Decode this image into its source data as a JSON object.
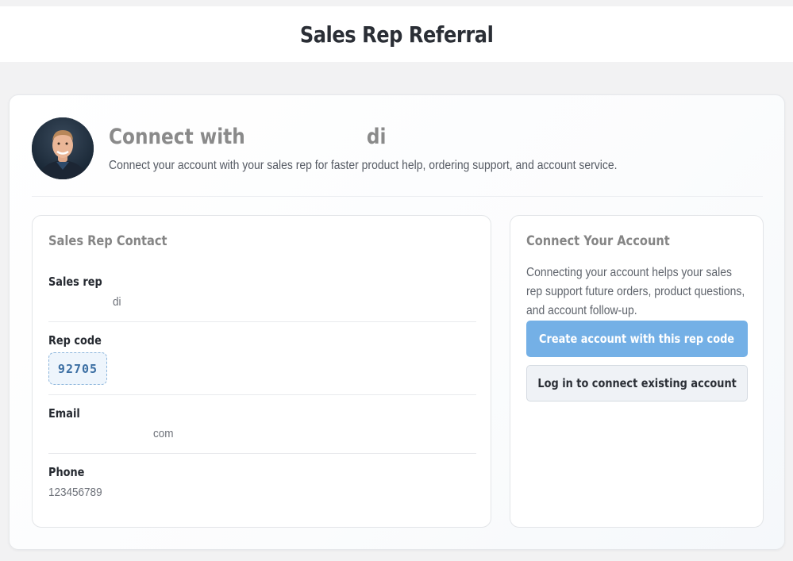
{
  "header": {
    "title": "Sales Rep Referral"
  },
  "hero": {
    "avatar_alt": "avatar",
    "title_prefix": "Connect with",
    "title_suffix": "di",
    "subtitle": "Connect your account with your sales rep for faster product help, ordering support, and account service."
  },
  "contact": {
    "title": "Sales Rep Contact",
    "sales_rep_label": "Sales rep",
    "sales_rep_value": "di",
    "rep_code_label": "Rep code",
    "rep_code_value": "92705",
    "email_label": "Email",
    "email_value": "com",
    "phone_label": "Phone",
    "phone_value": "123456789"
  },
  "connect": {
    "title": "Connect Your Account",
    "description": "Connecting your account helps your sales rep support future orders, product questions, and account follow-up.",
    "create_button": "Create account with this rep code",
    "login_button": "Log in to connect existing account"
  },
  "colors": {
    "primary_button": "#74b0e6",
    "rep_code_text": "#3c6fa3",
    "page_background": "#f2f2f3"
  }
}
